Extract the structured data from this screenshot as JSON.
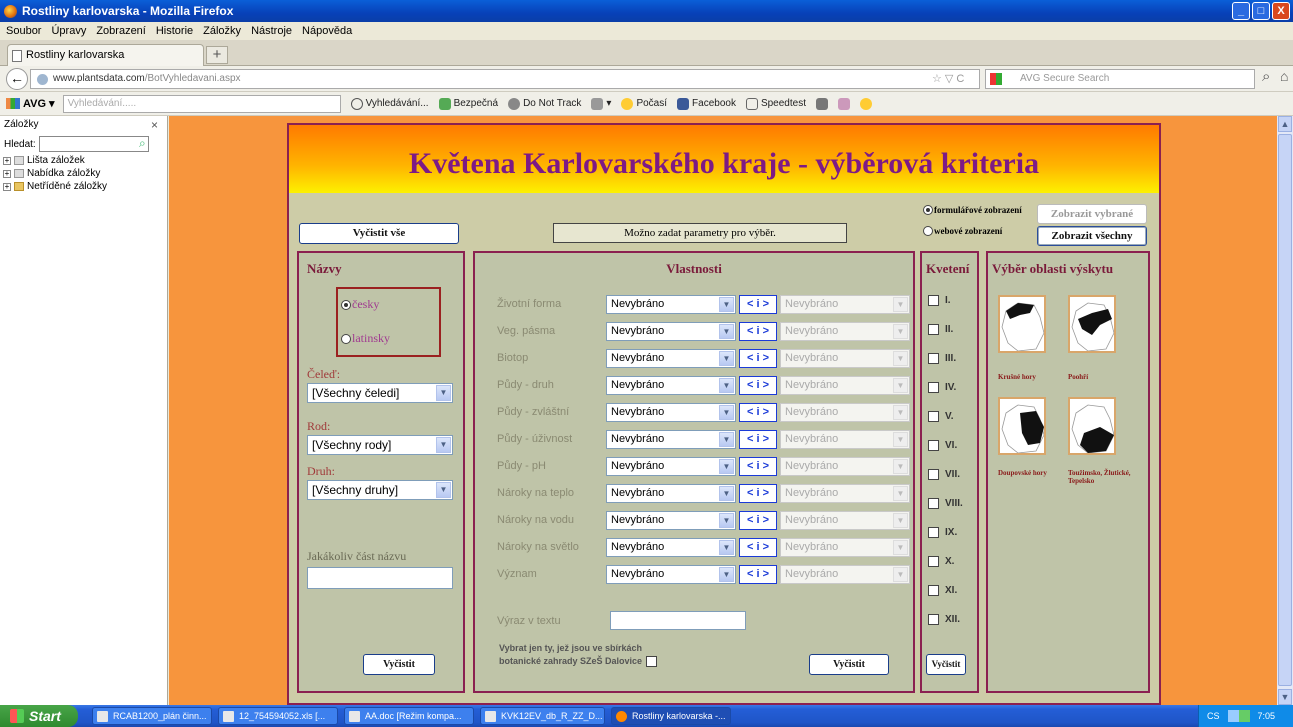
{
  "window": {
    "title": "Rostliny karlovarska - Mozilla Firefox",
    "minimize": "_",
    "maximize": "□",
    "close": "X"
  },
  "menu": [
    "Soubor",
    "Úpravy",
    "Zobrazení",
    "Historie",
    "Záložky",
    "Nástroje",
    "Nápověda"
  ],
  "tab": {
    "label": "Rostliny karlovarska",
    "new": "+"
  },
  "nav": {
    "back": "←",
    "url_domain": "www.plantsdata.com",
    "url_path": "/BotVyhledavani.aspx",
    "url_icons": "☆ ▽ C",
    "search_placeholder": "AVG Secure Search",
    "search_icon": "search-icon",
    "home_icon": "home-icon"
  },
  "avg": {
    "logo": "AVG",
    "dropdown": "▾",
    "search_placeholder": "Vyhledávání.....",
    "items": [
      "Vyhledávání...",
      "Bezpečná",
      "Do Not Track",
      "▾",
      "Počasí",
      "Facebook",
      "Speedtest"
    ]
  },
  "sidebar": {
    "title": "Záložky",
    "close": "×",
    "search_label": "Hledat:",
    "items": [
      "Lišta záložek",
      "Nabídka záložky",
      "Netříděné záložky"
    ]
  },
  "page": {
    "title": "Květena Karlovarského kraje - výběrová kriteria",
    "clear_all": "Vyčistit vše",
    "note": "Možno zadat parametry pro výběr.",
    "view_form": "formulářové zobrazení",
    "view_web": "webové zobrazení",
    "show_selected": "Zobrazit vybrané",
    "show_all": "Zobrazit všechny"
  },
  "nazvy": {
    "title": "Názvy",
    "czech": "česky",
    "latin": "latinsky",
    "family_label": "Čeleď:",
    "family_value": "[Všechny čeledi]",
    "genus_label": "Rod:",
    "genus_value": "[Všechny rody]",
    "species_label": "Druh:",
    "species_value": "[Všechny druhy]",
    "anypart_label": "Jakákoliv část názvu",
    "clear": "Vyčistit"
  },
  "vlastnosti": {
    "title": "Vlastnosti",
    "rows": [
      {
        "label": "Životní forma",
        "value": "Nevybráno",
        "range": "< i >",
        "second": "Nevybráno"
      },
      {
        "label": "Veg. pásma",
        "value": "Nevybráno",
        "range": "< i >",
        "second": "Nevybráno"
      },
      {
        "label": "Biotop",
        "value": "Nevybráno",
        "range": "< i >",
        "second": "Nevybráno"
      },
      {
        "label": "Půdy - druh",
        "value": "Nevybráno",
        "range": "< i >",
        "second": "Nevybráno"
      },
      {
        "label": "Půdy - zvláštní",
        "value": "Nevybráno",
        "range": "< i >",
        "second": "Nevybráno"
      },
      {
        "label": "Půdy - úživnost",
        "value": "Nevybráno",
        "range": "< i >",
        "second": "Nevybráno"
      },
      {
        "label": "Půdy - pH",
        "value": "Nevybráno",
        "range": "< i >",
        "second": "Nevybráno"
      },
      {
        "label": "Nároky na teplo",
        "value": "Nevybráno",
        "range": "< i >",
        "second": "Nevybráno"
      },
      {
        "label": "Nároky na vodu",
        "value": "Nevybráno",
        "range": "< i >",
        "second": "Nevybráno"
      },
      {
        "label": "Nároky na světlo",
        "value": "Nevybráno",
        "range": "< i >",
        "second": "Nevybráno"
      },
      {
        "label": "Význam",
        "value": "Nevybráno",
        "range": "< i >",
        "second": "Nevybráno"
      }
    ],
    "text_label": "Výraz v textu",
    "garden_line1": "Vybrat jen ty, jež jsou ve sbírkách",
    "garden_line2": "botanické zahrady  SZeŠ Dalovice",
    "clear": "Vyčistit"
  },
  "kveteni": {
    "title": "Kvetení",
    "months": [
      "I.",
      "II.",
      "III.",
      "IV.",
      "V.",
      "VI.",
      "VII.",
      "VIII.",
      "IX.",
      "X.",
      "XI.",
      "XII."
    ],
    "clear": "Vyčistit"
  },
  "oblast": {
    "title": "Výběr oblasti výskytu",
    "maps": [
      "Krušné hory",
      "Poohří",
      "Doupovské hory",
      "Toužimsko, Žlutické, Tepelsko"
    ]
  },
  "taskbar": {
    "start": "Start",
    "tasks": [
      "RCAB1200_plán činn...",
      "12_754594052.xls [...",
      "AA.doc [Režim kompa...",
      "KVK12EV_db_R_ZZ_D...",
      "Rostliny karlovarska -..."
    ],
    "lang": "CS",
    "time": "7:05"
  }
}
